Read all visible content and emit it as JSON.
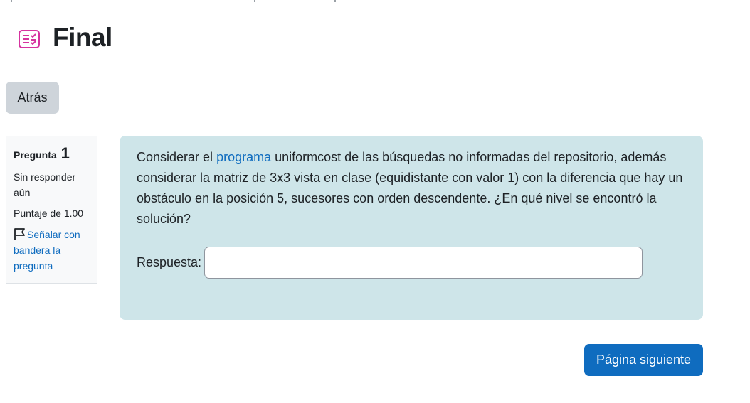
{
  "header": {
    "icon": "quiz-icon",
    "title": "Final",
    "accent_color": "#d6339f"
  },
  "navigation": {
    "back_label": "Atrás",
    "next_label": "Página siguiente"
  },
  "question_info": {
    "label": "Pregunta",
    "number": "1",
    "state": "Sin responder aún",
    "grade": "Puntaje de 1.00",
    "flag_icon": "flag-icon",
    "flag_label": "Señalar con bandera la pregunta"
  },
  "question": {
    "text_before_link": "Considerar el ",
    "link_text": "programa",
    "text_after_link": " uniformcost de las búsquedas no informadas del repositorio, además considerar la matriz de 3x3 vista en clase (equidistante con valor 1) con la diferencia que hay un obstáculo en la posición 5, sucesores con orden descendente. ¿En qué nivel se encontró la solución?",
    "answer_label": "Respuesta:",
    "answer_value": ""
  },
  "colors": {
    "link": "#0f6cbf",
    "question_bg": "#cee5e9",
    "primary_button": "#0f6cbf",
    "secondary_button": "#ced4da"
  }
}
